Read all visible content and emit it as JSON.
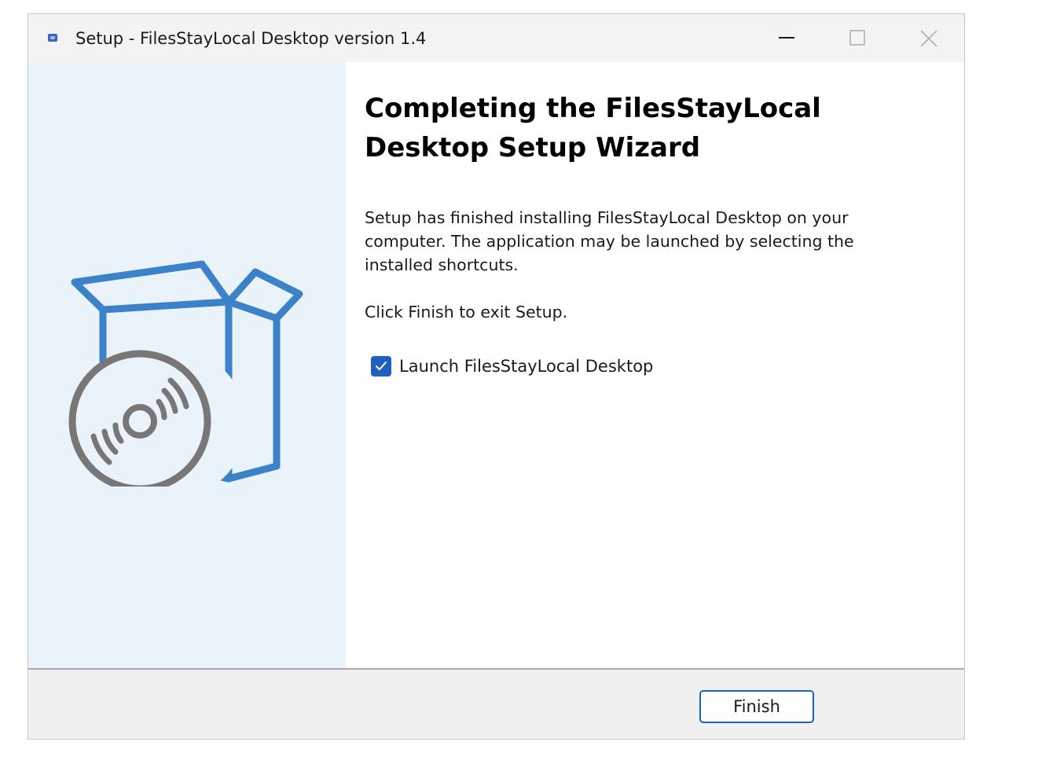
{
  "window": {
    "title": "Setup - FilesStayLocal Desktop version 1.4",
    "icons": {
      "app": "app-icon",
      "minimize": "minimize-icon",
      "maximize": "maximize-icon",
      "close": "close-icon"
    }
  },
  "side_panel": {
    "illustration": "software-box-with-disc-icon",
    "colors": {
      "background": "#eaf2fa",
      "box": "#3b82c9",
      "disc": "#777777"
    }
  },
  "content": {
    "heading": "Completing the FilesStayLocal Desktop Setup Wizard",
    "paragraph_1": "Setup has finished installing FilesStayLocal Desktop on your computer. The application may be launched by selecting the installed shortcuts.",
    "paragraph_2": "Click Finish to exit Setup.",
    "launch_checkbox": {
      "label": "Launch FilesStayLocal Desktop",
      "checked": true
    }
  },
  "footer": {
    "finish_label": "Finish"
  },
  "colors": {
    "accent": "#1f5fbf",
    "titlebar": "#f3f3f3",
    "footer": "#f0f0f0"
  }
}
